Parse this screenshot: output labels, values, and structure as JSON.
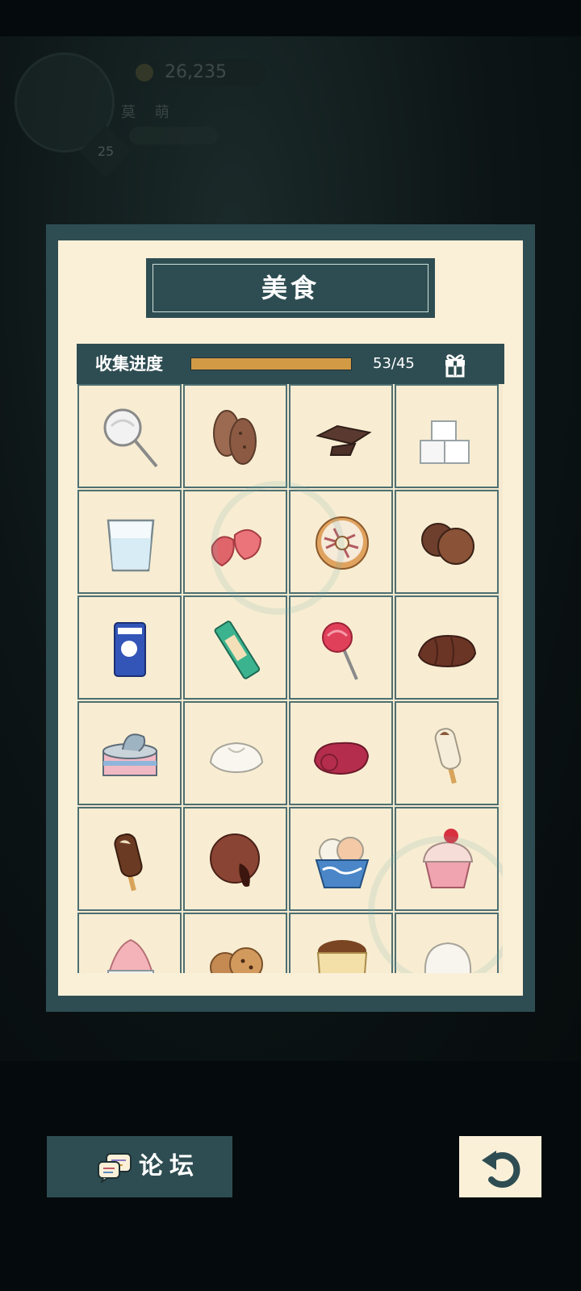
{
  "hud": {
    "coins": "26,235",
    "level": "25",
    "chip_1": "莫",
    "chip_2": "萌"
  },
  "panel": {
    "title": "美食",
    "progress_label": "收集进度",
    "progress_count": "53/45",
    "progress_fraction": 1.0
  },
  "items": [
    {
      "icon": "white-lollipop-icon"
    },
    {
      "icon": "cookies-icon"
    },
    {
      "icon": "chocolate-pieces-icon"
    },
    {
      "icon": "sugar-cubes-icon"
    },
    {
      "icon": "milk-glass-icon"
    },
    {
      "icon": "dried-strawberry-icon"
    },
    {
      "icon": "donut-icon"
    },
    {
      "icon": "chocolate-truffles-icon"
    },
    {
      "icon": "candy-packet-icon"
    },
    {
      "icon": "snack-bar-icon"
    },
    {
      "icon": "red-lollipop-icon"
    },
    {
      "icon": "chocolate-croissant-icon"
    },
    {
      "icon": "canned-food-icon"
    },
    {
      "icon": "steamed-bun-icon"
    },
    {
      "icon": "red-bean-roll-icon"
    },
    {
      "icon": "vanilla-ice-pop-icon"
    },
    {
      "icon": "chocolate-ice-pop-icon"
    },
    {
      "icon": "chocolate-lava-cake-icon"
    },
    {
      "icon": "ice-cream-bowl-icon"
    },
    {
      "icon": "cupcake-icon"
    },
    {
      "icon": "shaved-ice-icon"
    },
    {
      "icon": "chip-cookies-icon"
    },
    {
      "icon": "pudding-icon"
    },
    {
      "icon": "mochi-icon"
    }
  ],
  "footer": {
    "forum_label": "论坛"
  },
  "colors": {
    "panel_teal": "#2e4d52",
    "paper": "#faf0d8",
    "progress_fill": "#d39a45"
  }
}
